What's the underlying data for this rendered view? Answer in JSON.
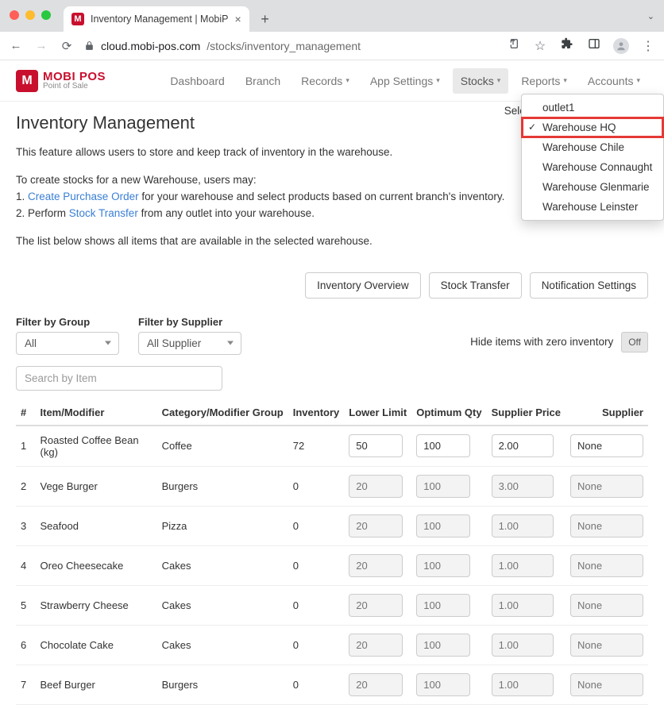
{
  "browser": {
    "tab_title": "Inventory Management | MobiP",
    "url_host": "cloud.mobi-pos.com",
    "url_path": "/stocks/inventory_management"
  },
  "logo": {
    "brand": "MOBI POS",
    "tagline": "Point of Sale",
    "badge": "M"
  },
  "nav": {
    "items": [
      {
        "label": "Dashboard",
        "dropdown": false,
        "active": false
      },
      {
        "label": "Branch",
        "dropdown": false,
        "active": false
      },
      {
        "label": "Records",
        "dropdown": true,
        "active": false
      },
      {
        "label": "App Settings",
        "dropdown": true,
        "active": false
      },
      {
        "label": "Stocks",
        "dropdown": true,
        "active": true
      },
      {
        "label": "Reports",
        "dropdown": true,
        "active": false
      },
      {
        "label": "Accounts",
        "dropdown": true,
        "active": false
      }
    ]
  },
  "page": {
    "title": "Inventory Management",
    "intro1": "This feature allows users to store and keep track of inventory in the warehouse.",
    "intro2_lead": "To create stocks for a new Warehouse, users may:",
    "intro2_1_pre": "1. ",
    "intro2_1_link": "Create Purchase Order",
    "intro2_1_post": " for your warehouse and select products based on current branch's inventory.",
    "intro2_2_pre": "2. Perform ",
    "intro2_2_link": "Stock Transfer",
    "intro2_2_post": " from any outlet into your warehouse.",
    "intro3": "The list below shows all items that are available in the selected warehouse.",
    "select_label": "Select:"
  },
  "warehouse_menu": {
    "options": [
      {
        "label": "outlet1",
        "selected": false,
        "highlight": false
      },
      {
        "label": "Warehouse HQ",
        "selected": true,
        "highlight": true
      },
      {
        "label": "Warehouse Chile",
        "selected": false,
        "highlight": false
      },
      {
        "label": "Warehouse Connaught",
        "selected": false,
        "highlight": false
      },
      {
        "label": "Warehouse Glenmarie",
        "selected": false,
        "highlight": false
      },
      {
        "label": "Warehouse Leinster",
        "selected": false,
        "highlight": false
      }
    ]
  },
  "actions": {
    "overview": "Inventory Overview",
    "transfer": "Stock Transfer",
    "notify": "Notification Settings"
  },
  "filters": {
    "group_label": "Filter by Group",
    "group_value": "All",
    "supplier_label": "Filter by Supplier",
    "supplier_value": "All Supplier",
    "hide_zero_label": "Hide items with zero inventory",
    "hide_zero_toggle": "Off",
    "search_placeholder": "Search by Item"
  },
  "table": {
    "headers": {
      "idx": "#",
      "item": "Item/Modifier",
      "category": "Category/Modifier Group",
      "inventory": "Inventory",
      "lower": "Lower Limit",
      "optimum": "Optimum Qty",
      "price": "Supplier Price",
      "supplier": "Supplier"
    },
    "rows": [
      {
        "idx": "1",
        "item": "Roasted Coffee Bean (kg)",
        "category": "Coffee",
        "inventory": "72",
        "lower": "50",
        "optimum": "100",
        "price": "2.00",
        "supplier": "None",
        "enabled": true
      },
      {
        "idx": "2",
        "item": "Vege Burger",
        "category": "Burgers",
        "inventory": "0",
        "lower": "20",
        "optimum": "100",
        "price": "3.00",
        "supplier": "None",
        "enabled": false
      },
      {
        "idx": "3",
        "item": "Seafood",
        "category": "Pizza",
        "inventory": "0",
        "lower": "20",
        "optimum": "100",
        "price": "1.00",
        "supplier": "None",
        "enabled": false
      },
      {
        "idx": "4",
        "item": "Oreo Cheesecake",
        "category": "Cakes",
        "inventory": "0",
        "lower": "20",
        "optimum": "100",
        "price": "1.00",
        "supplier": "None",
        "enabled": false
      },
      {
        "idx": "5",
        "item": "Strawberry Cheese",
        "category": "Cakes",
        "inventory": "0",
        "lower": "20",
        "optimum": "100",
        "price": "1.00",
        "supplier": "None",
        "enabled": false
      },
      {
        "idx": "6",
        "item": "Chocolate Cake",
        "category": "Cakes",
        "inventory": "0",
        "lower": "20",
        "optimum": "100",
        "price": "1.00",
        "supplier": "None",
        "enabled": false
      },
      {
        "idx": "7",
        "item": "Beef Burger",
        "category": "Burgers",
        "inventory": "0",
        "lower": "20",
        "optimum": "100",
        "price": "1.00",
        "supplier": "None",
        "enabled": false
      }
    ]
  }
}
